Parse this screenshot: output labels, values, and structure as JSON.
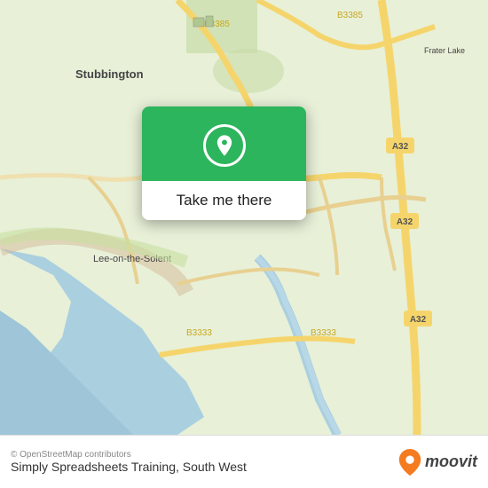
{
  "map": {
    "attribution": "© OpenStreetMap contributors",
    "background_color": "#e8f0d8",
    "water_color": "#aad3df",
    "road_color": "#f7e0a0",
    "road_color_main": "#f5d56b"
  },
  "popup": {
    "button_label": "Take me there",
    "icon_color": "#ffffff",
    "bg_color": "#2db55d"
  },
  "bottom_bar": {
    "title": "Simply Spreadsheets Training, South West",
    "moovit_label": "moovit",
    "attribution": "© OpenStreetMap contributors"
  }
}
